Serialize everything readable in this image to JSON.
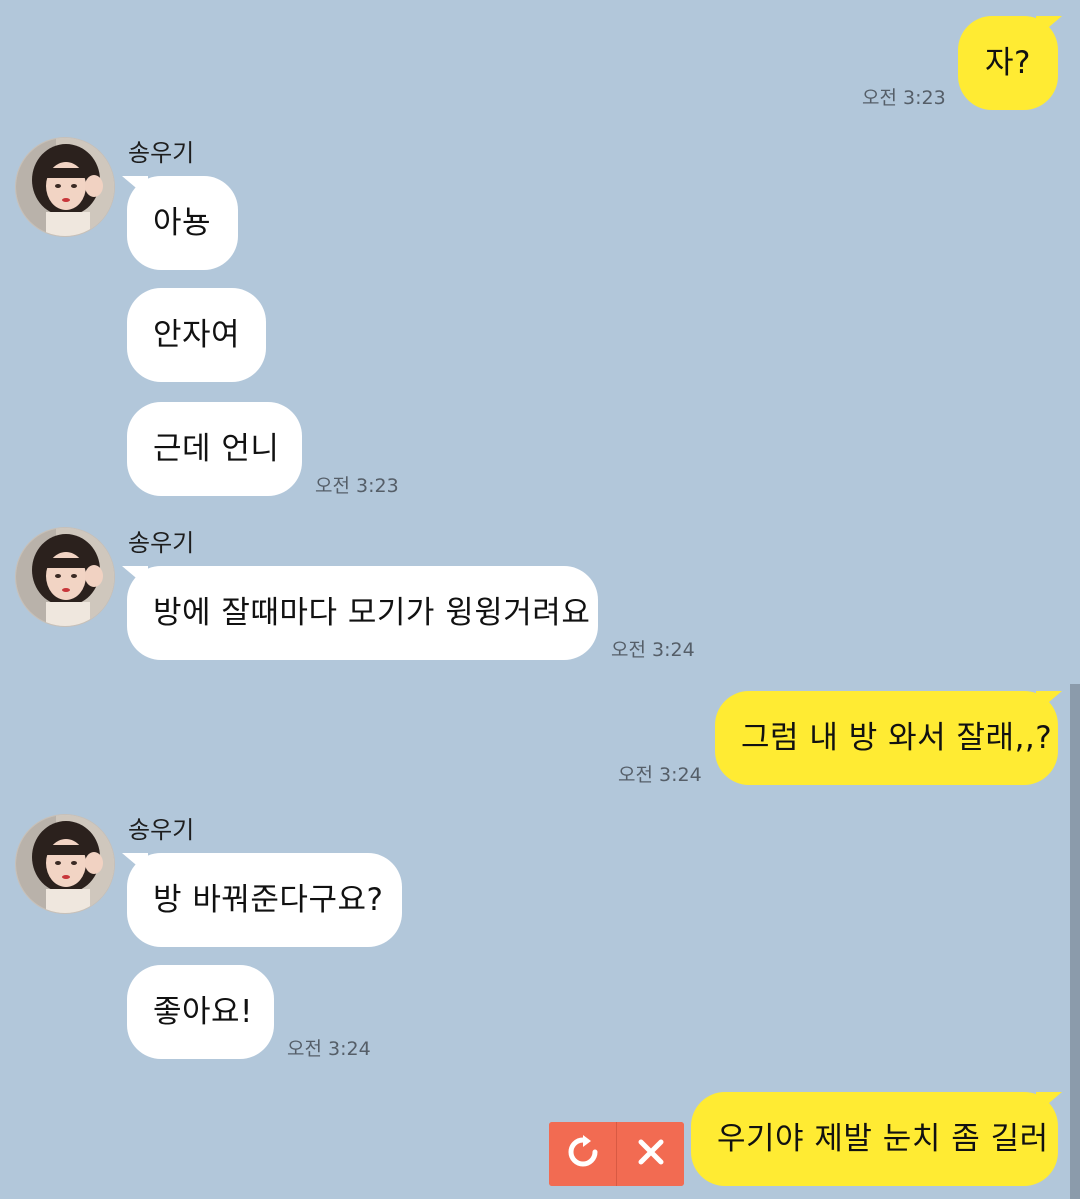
{
  "contact": {
    "name": "송우기"
  },
  "colors": {
    "background": "#b2c7da",
    "incoming_bubble": "#ffffff",
    "outgoing_bubble": "#ffeb33",
    "failed_action": "#f26b52"
  },
  "messages": {
    "m1": {
      "sender": "me",
      "text": "자?",
      "time": "오전 3:23"
    },
    "m2": {
      "sender": "송우기",
      "text": "아뇽"
    },
    "m3": {
      "sender": "송우기",
      "text": "안자여"
    },
    "m4": {
      "sender": "송우기",
      "text": "근데 언니",
      "time": "오전 3:23"
    },
    "m5": {
      "sender": "송우기",
      "text": "방에 잘때마다 모기가 윙윙거려요",
      "time": "오전 3:24"
    },
    "m6": {
      "sender": "me",
      "text": "그럼 내 방 와서 잘래,,?",
      "time": "오전 3:24"
    },
    "m7": {
      "sender": "송우기",
      "text": "방 바꿔준다구요?"
    },
    "m8": {
      "sender": "송우기",
      "text": "좋아요!",
      "time": "오전 3:24"
    },
    "m9": {
      "sender": "me",
      "text": "우기야 제발 눈치 좀 길러",
      "status": "failed"
    }
  },
  "failed_actions": {
    "retry_icon": "retry-icon",
    "delete_icon": "close-icon"
  }
}
